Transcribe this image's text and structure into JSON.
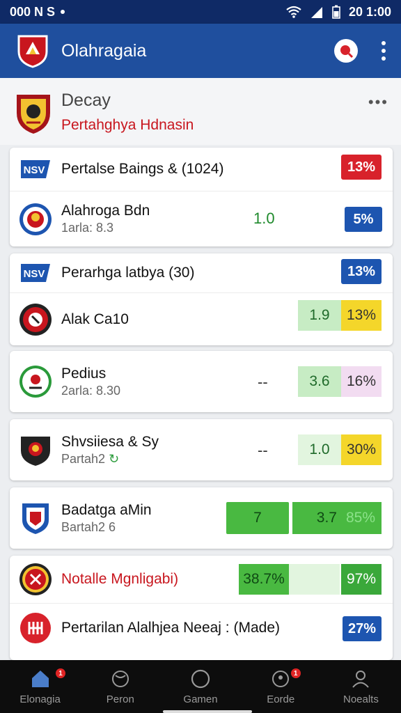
{
  "status": {
    "left": "000 N S",
    "time": "20 1:00"
  },
  "app": {
    "title": "Olahragaia"
  },
  "league": {
    "title": "Decay",
    "subtitle": "Pertahghya Hdnasin",
    "more": "•••"
  },
  "cards": [
    {
      "rows": [
        {
          "logo": "NSV",
          "title": "Pertalse Baings & (1024)",
          "badge": "13%"
        },
        {
          "title": "Alahroga Bdn",
          "sub": "1arla: 8.3",
          "odds": "1.0",
          "badge": "5%"
        }
      ]
    },
    {
      "rows": [
        {
          "logo": "NSV",
          "title": "Perarhga latbya (30)",
          "badge": "13%"
        },
        {
          "title": "Alak Ca10",
          "odds": "1.9",
          "pct": "13%"
        }
      ]
    },
    {
      "rows": [
        {
          "title": "Pedius",
          "sub": "2arla: 8.30",
          "dash": "--",
          "odds": "3.6",
          "pct": "16%"
        }
      ]
    },
    {
      "rows": [
        {
          "title": "Shvsiiesa & Sy",
          "sub": "Partah2",
          "dash": "--",
          "odds": "1.0",
          "pct": "30%"
        }
      ]
    },
    {
      "rows": [
        {
          "title": "Badatga aMin",
          "sub": "Bartah2 6",
          "odds1": "7",
          "odds2": "3.7",
          "pct": "85%"
        }
      ]
    },
    {
      "rows": [
        {
          "title": "Notalle Mgnligabi)",
          "odds": "38.7%",
          "pct": "97%"
        },
        {
          "title": "Pertarilan Alalhjea Neeaj : (Made)",
          "badge": "27%"
        }
      ]
    }
  ],
  "nav": [
    {
      "label": "Elonagia",
      "icon": "home-icon",
      "badge": "1"
    },
    {
      "label": "Peron",
      "icon": "sport-icon"
    },
    {
      "label": "Gamen",
      "icon": "game-icon"
    },
    {
      "label": "Eorde",
      "icon": "score-icon",
      "badge": "1"
    },
    {
      "label": "Noealts",
      "icon": "profile-icon"
    }
  ],
  "colors": {
    "primary": "#1f4f9e",
    "status": "#0f2a66",
    "red": "#d8222b",
    "blue": "#1d55b0",
    "green": "#3fb53c",
    "yellow": "#f2d21f"
  }
}
